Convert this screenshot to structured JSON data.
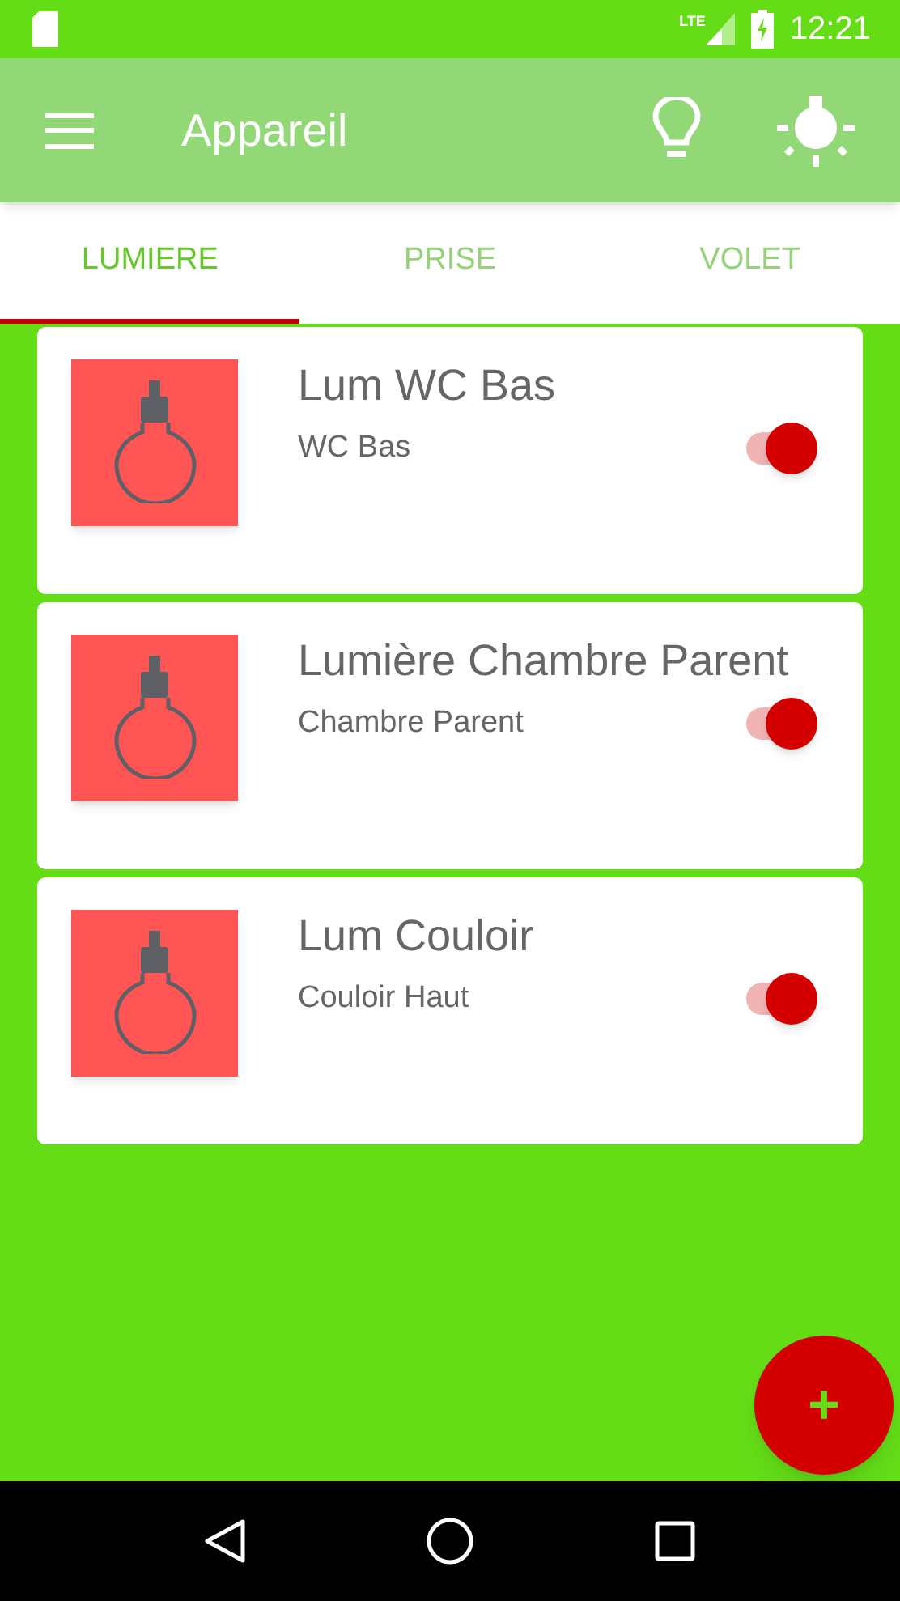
{
  "status_bar": {
    "network": "LTE",
    "time": "12:21"
  },
  "app_bar": {
    "title": "Appareil"
  },
  "tabs": [
    {
      "label": "LUMIERE",
      "selected": true
    },
    {
      "label": "PRISE",
      "selected": false
    },
    {
      "label": "VOLET",
      "selected": false
    }
  ],
  "devices": [
    {
      "name": "Lum WC Bas",
      "room": "WC Bas",
      "on": true
    },
    {
      "name": "Lumière Chambre Parent",
      "room": "Chambre Parent",
      "on": true
    },
    {
      "name": "Lum Couloir",
      "room": "Couloir Haut",
      "on": true
    }
  ],
  "fab": {
    "label": "+"
  }
}
